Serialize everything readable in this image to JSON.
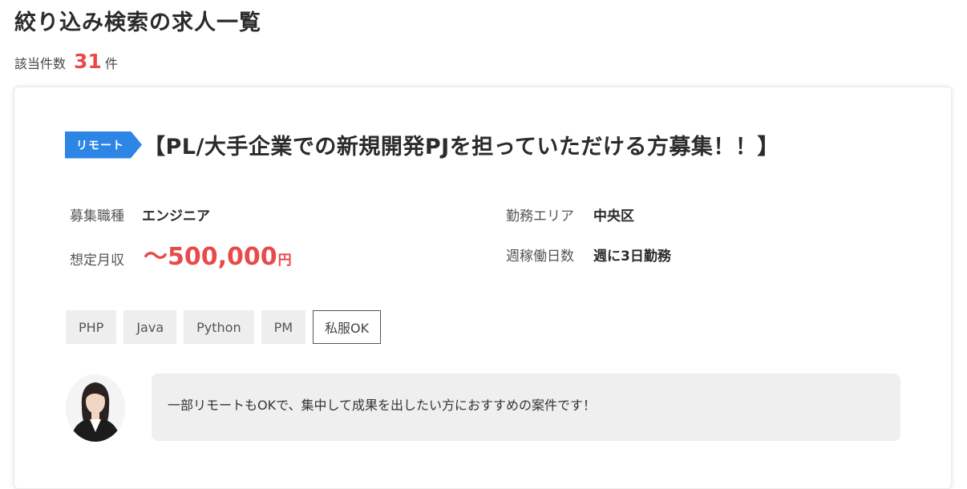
{
  "page": {
    "title": "絞り込み検索の求人一覧",
    "count_label": "該当件数",
    "count_value": "31",
    "count_unit": "件"
  },
  "job": {
    "badge": "リモート",
    "title": "【PL/大手企業での新規開発PJを担っていただける方募集！！】",
    "fields": {
      "job_type_label": "募集職種",
      "job_type_value": "エンジニア",
      "area_label": "勤務エリア",
      "area_value": "中央区",
      "salary_label": "想定月収",
      "salary_value": "〜500,000",
      "salary_unit": "円",
      "days_label": "週稼働日数",
      "days_value": "週に3日勤務"
    },
    "tags": [
      "PHP",
      "Java",
      "Python",
      "PM",
      "私服OK"
    ],
    "comment": "一部リモートもOKで、集中して成果を出したい方におすすめの案件です！"
  },
  "colors": {
    "accent_red": "#e84a4a",
    "badge_blue": "#2d86e6"
  }
}
